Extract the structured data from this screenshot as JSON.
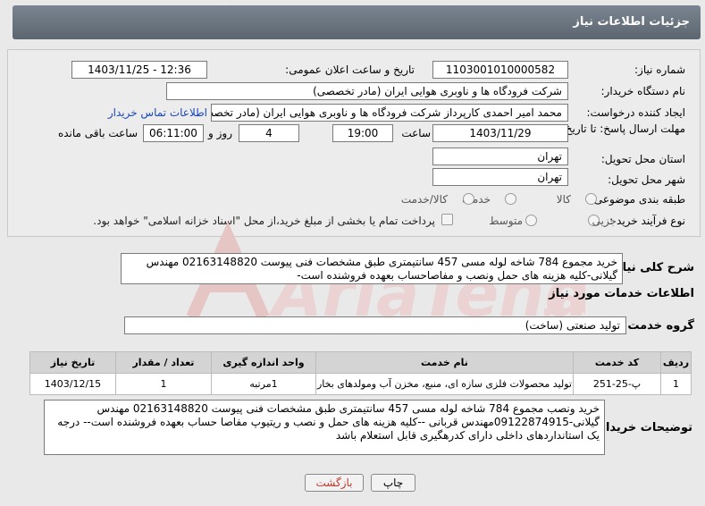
{
  "header": {
    "title": "جزئیات اطلاعات نیاز"
  },
  "form": {
    "need_number": {
      "label": "شماره نیاز:",
      "value": "1103001010000582"
    },
    "announce_datetime": {
      "label": "تاریخ و ساعت اعلان عمومی:",
      "value": "1403/11/25 - 12:36"
    },
    "buyer_org": {
      "label": "نام دستگاه خریدار:",
      "value": "شرکت فرودگاه ها و ناوبری هوایی ایران (مادر تخصصی)"
    },
    "creator": {
      "label": "ایجاد کننده درخواست:",
      "value": "محمد امیر احمدی کارپرداز شرکت فرودگاه ها و ناوبری هوایی ایران (مادر تخصصی",
      "contact_link": "اطلاعات تماس خریدار"
    },
    "deadline": {
      "label": "مهلت ارسال پاسخ: تا تاریخ:",
      "date": "1403/11/29",
      "time_label": "ساعت",
      "time": "19:00",
      "days": "4",
      "days_label": "روز و",
      "remaining": "06:11:00",
      "remaining_label": "ساعت باقی مانده"
    },
    "province": {
      "label": "استان محل تحویل:",
      "value": "تهران"
    },
    "city": {
      "label": "شهر محل تحویل:",
      "value": "تهران"
    },
    "category": {
      "label": "طبقه بندی موضوعی:",
      "options": [
        "کالا",
        "خدمت",
        "کالا/خدمت"
      ]
    },
    "process": {
      "label": "نوع فرآیند خرید :",
      "options": [
        "جزیی",
        "متوسط"
      ],
      "payment_note": "پرداخت تمام یا بخشی از مبلغ خرید،از محل \"اسناد خزانه اسلامی\" خواهد بود."
    }
  },
  "description": {
    "label": "شرح کلی نیاز:",
    "text": "خرید مجموع 784 شاخه لوله مسی 457 سانتیمتری طبق مشخصات فنی پیوست 02163148820 مهندس گیلانی-کلیه هزینه های حمل ونصب و مفاصاحساب  بعهده فروشنده است-"
  },
  "services": {
    "section_title": "اطلاعات خدمات مورد نیاز",
    "group_label": "گروه خدمت:",
    "group_value": "تولید صنعتی (ساخت)",
    "columns": [
      "ردیف",
      "کد خدمت",
      "نام خدمت",
      "واحد اندازه گیری",
      "تعداد / مقدار",
      "تاریخ نیاز"
    ],
    "rows": [
      [
        "1",
        "پ-25-251",
        "تولید محصولات فلزی سازه ای، منبع، مخزن آب ومولدهای بخار",
        "1مرتبه",
        "1",
        "1403/12/15"
      ]
    ]
  },
  "buyer_notes": {
    "label": "توضیحات خریدار:",
    "text": "خرید ونصب مجموع 784 شاخه لوله مسی 457 سانتیمتری طبق مشخصات فنی پیوست 02163148820 مهندس گیلانی-09122874915مهندس قربانی --کلیه هزینه های حمل و نصب و ریتیوپ مفاصا حساب بعهده فروشنده است-- درجه یک استانداردهای داخلی دارای کدرهگیری قابل استعلام باشد"
  },
  "buttons": {
    "print": "چاپ",
    "back": "بازگشت"
  },
  "colors": {
    "header_bg": "#6b7580",
    "link": "#1a47b8",
    "back_text": "#c0392b",
    "watermark": "#e6c5c5"
  }
}
